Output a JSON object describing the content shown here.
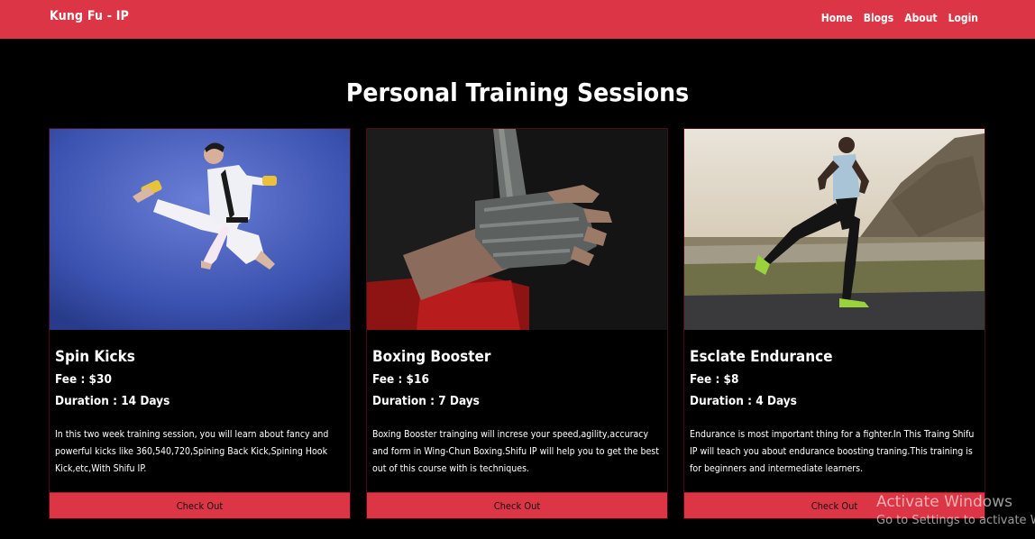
{
  "nav": {
    "brand": "Kung Fu - IP",
    "links": [
      "Home",
      "Blogs",
      "About",
      "Login"
    ]
  },
  "page": {
    "title": "Personal Training Sessions"
  },
  "cards": [
    {
      "title": "Spin Kicks",
      "fee": "Fee : $30",
      "duration": "Duration : 14 Days",
      "description": "In this two week training session, you will learn about fancy and powerful kicks like 360,540,720,Spining Back Kick,Spining Hook Kick,etc,With Shifu IP.",
      "button": "Check Out"
    },
    {
      "title": "Boxing Booster",
      "fee": "Fee : $16",
      "duration": "Duration : 7 Days",
      "description": "Boxing Booster trainging will increse your speed,agility,accuracy and form in Wing-Chun Boxing.Shifu IP will help you to get the best out of this course with is techniques.",
      "button": "Check Out"
    },
    {
      "title": "Esclate Endurance",
      "fee": "Fee : $8",
      "duration": "Duration : 4 Days",
      "description": "Endurance is most important thing for a fighter.In This Traing Shifu IP will teach you about endurance boosting traning.This training is for beginners and intermediate learners.",
      "button": "Check Out"
    }
  ],
  "watermark": {
    "title": "Activate Windows",
    "subtitle": "Go to Settings to activate W"
  },
  "colors": {
    "accent": "#dc3545",
    "background": "#000000"
  }
}
